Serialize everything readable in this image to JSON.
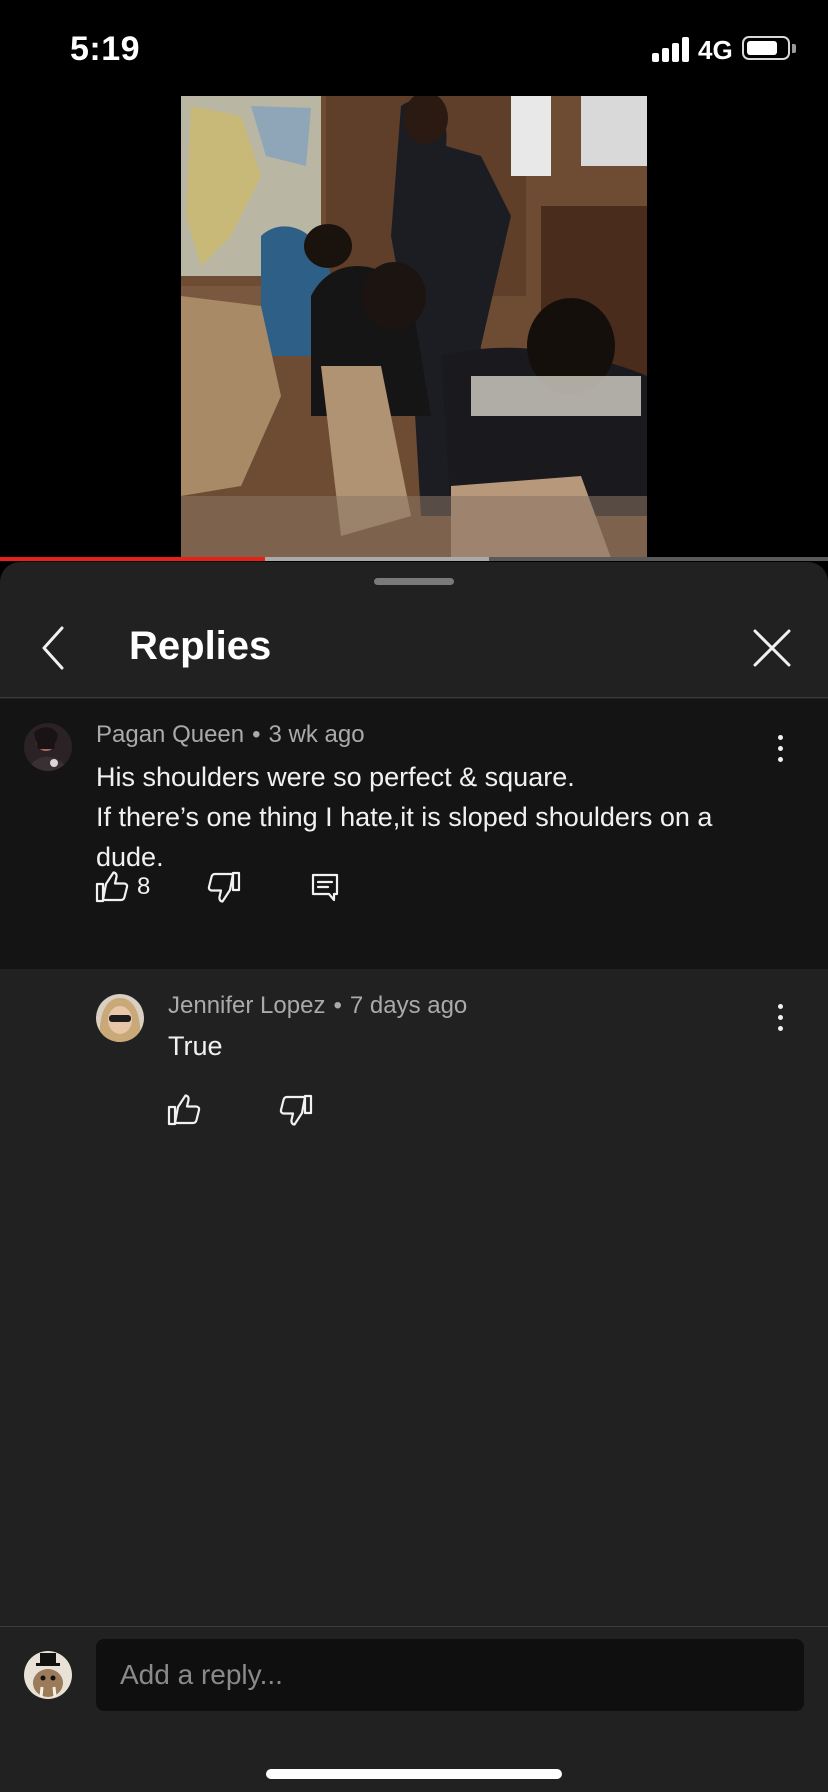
{
  "status_bar": {
    "time": "5:19",
    "network": "4G"
  },
  "video": {
    "progress_played_fraction": 0.32,
    "progress_buffered_fraction": 0.59
  },
  "sheet": {
    "title": "Replies"
  },
  "comment": {
    "author": "Pagan Queen",
    "separator": "•",
    "time": "3 wk ago",
    "lines": [
      "His shoulders were so perfect & square.",
      "If there’s one thing I hate,it is sloped shoulders on a dude."
    ],
    "likes": "8"
  },
  "reply": {
    "author": "Jennifer Lopez",
    "separator": "•",
    "time": "7 days ago",
    "text": "True"
  },
  "reply_input": {
    "placeholder": "Add a reply..."
  },
  "colors": {
    "progress": "#e62117",
    "sheet_bg": "#212121",
    "comment_bg": "#141414"
  },
  "icons": [
    "signal-icon",
    "battery-icon",
    "back-arrow-icon",
    "close-icon",
    "more-vert-icon",
    "thumbs-up-icon",
    "thumbs-down-icon",
    "reply-comment-icon"
  ]
}
